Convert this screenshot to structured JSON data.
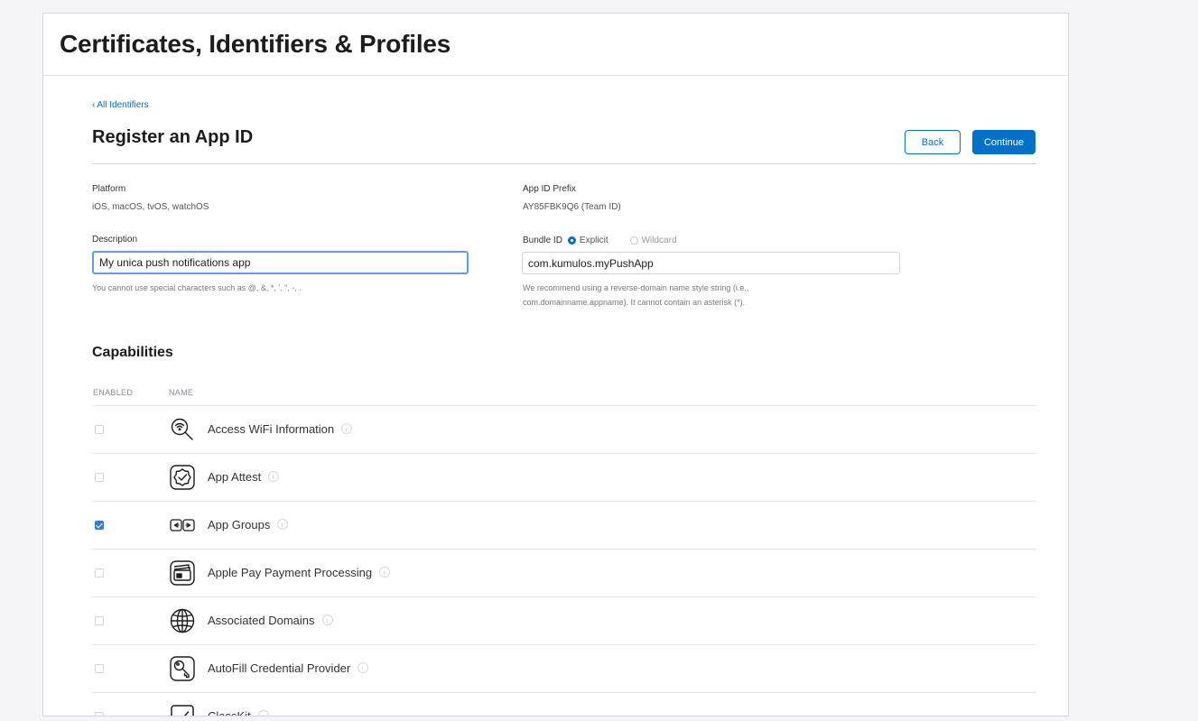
{
  "header": {
    "title": "Certificates, Identifiers & Profiles"
  },
  "breadcrumb": {
    "chevron": "‹",
    "label": "All Identifiers"
  },
  "section": {
    "title": "Register an App ID",
    "back_label": "Back",
    "continue_label": "Continue"
  },
  "platform": {
    "label": "Platform",
    "value": "iOS, macOS, tvOS, watchOS"
  },
  "app_id_prefix": {
    "label": "App ID Prefix",
    "value": "AY85FBK9Q6 (Team ID)"
  },
  "description": {
    "label": "Description",
    "value": "My unica push notifications app",
    "help": "You cannot use special characters such as @, &, *, ', \", -, ."
  },
  "bundle_id": {
    "label": "Bundle ID",
    "option_explicit": "Explicit",
    "option_wildcard": "Wildcard",
    "selected": "Explicit",
    "value": "com.kumulos.myPushApp",
    "help_line1": "We recommend using a reverse-domain name style string (i.e.,",
    "help_line2": "com.domainname.appname). It cannot contain an asterisk (*)."
  },
  "capabilities": {
    "title": "Capabilities",
    "col_enabled": "ENABLED",
    "col_name": "NAME",
    "rows": [
      {
        "name": "Access WiFi Information",
        "enabled": false,
        "icon": "wifi-search-icon"
      },
      {
        "name": "App Attest",
        "enabled": false,
        "icon": "app-attest-badge-icon"
      },
      {
        "name": "App Groups",
        "enabled": true,
        "icon": "app-groups-icon"
      },
      {
        "name": "Apple Pay Payment Processing",
        "enabled": false,
        "icon": "wallet-card-icon"
      },
      {
        "name": "Associated Domains",
        "enabled": false,
        "icon": "globe-icon"
      },
      {
        "name": "AutoFill Credential Provider",
        "enabled": false,
        "icon": "key-icon"
      },
      {
        "name": "ClassKit",
        "enabled": false,
        "icon": "classkit-checkbox-icon"
      }
    ]
  },
  "colors": {
    "accent": "#0070c9",
    "checked": "#2f7ddc",
    "focus_border": "#5a9ff0"
  }
}
